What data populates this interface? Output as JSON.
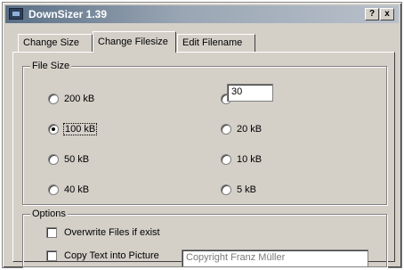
{
  "window": {
    "title": "DownSizer 1.39",
    "help_button": "?",
    "close_button": "x"
  },
  "tabs": [
    {
      "label": "Change Size",
      "active": false
    },
    {
      "label": "Change Filesize",
      "active": true
    },
    {
      "label": "Edit Filename",
      "active": false
    }
  ],
  "file_size": {
    "legend": "File Size",
    "options": [
      {
        "label": "200 kB",
        "checked": false
      },
      {
        "label": "100 kB",
        "checked": true
      },
      {
        "label": "50 kB",
        "checked": false
      },
      {
        "label": "40 kB",
        "checked": false
      },
      {
        "label": "",
        "checked": false
      },
      {
        "label": "20 kB",
        "checked": false
      },
      {
        "label": "10 kB",
        "checked": false
      },
      {
        "label": "5 kB",
        "checked": false
      }
    ],
    "custom_value": "30"
  },
  "options": {
    "legend": "Options",
    "overwrite_label": "Overwrite Files if exist",
    "overwrite_checked": false,
    "copy_text_label": "Copy Text into Picture",
    "copy_text_checked": false,
    "copyright_value": "Copyright Franz Müller"
  }
}
